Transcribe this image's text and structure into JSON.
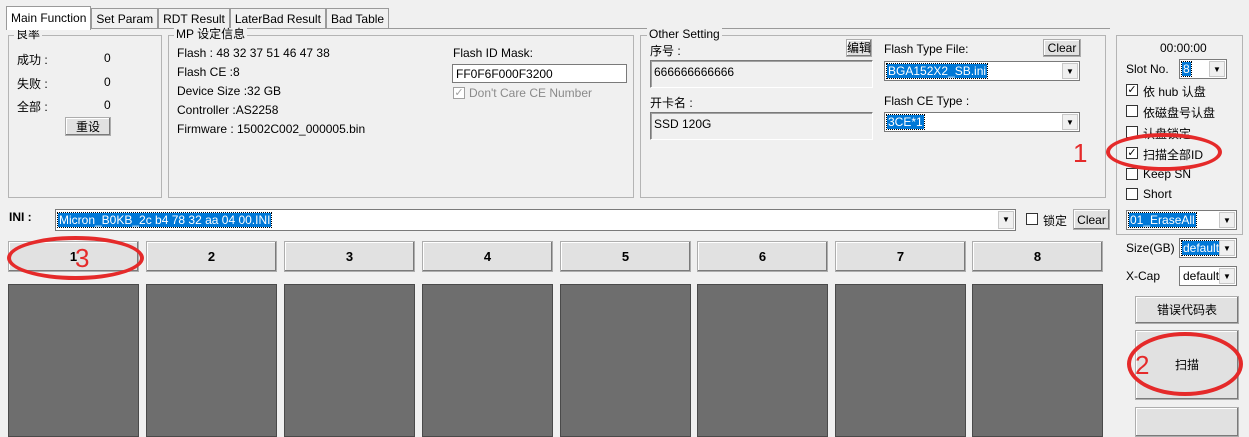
{
  "tabs": [
    "Main Function",
    "Set Param",
    "RDT Result",
    "LaterBad Result",
    "Bad Table"
  ],
  "good_group": {
    "legend": "良率",
    "rows": [
      {
        "label": "成功 :",
        "value": "0"
      },
      {
        "label": "失败 :",
        "value": "0"
      },
      {
        "label": "全部 :",
        "value": "0"
      }
    ],
    "reset_button": "重设"
  },
  "mp_info": {
    "legend": "MP 设定信息",
    "flash": "Flash :  48 32 37 51 46 47 38",
    "flash_ce": "Flash CE :8",
    "device_size": "Device Size :32 GB",
    "controller": "Controller :AS2258",
    "firmware": "Firmware : 15002C002_000005.bin",
    "flash_id_mask_label": "Flash ID Mask:",
    "flash_id_mask_value": "FF0F6F000F3200",
    "dont_care_ce_label": "Don't Care CE Number"
  },
  "other_setting": {
    "legend": "Other Setting",
    "serial_label": "序号 :",
    "edit_button": "编辑",
    "serial_value": "666666666666",
    "card_name_label": "开卡名 :",
    "card_name_value": "SSD 120G",
    "flash_type_file_label": "Flash Type File:",
    "clear_button": "Clear",
    "flash_type_file_value": "BGA152X2_SB.ini",
    "flash_ce_type_label": "Flash CE Type :",
    "flash_ce_type_value": "3CE*1"
  },
  "ini": {
    "label": "INI :",
    "value": "Micron_B0KB_2c b4 78 32 aa 04 00.INI",
    "lock_label": "锁定",
    "clear_button": "Clear"
  },
  "slots": [
    "1",
    "2",
    "3",
    "4",
    "5",
    "6",
    "7",
    "8"
  ],
  "right_panel": {
    "timer": "00:00:00",
    "slot_no_label": "Slot No.",
    "slot_no_value": "8",
    "options": [
      {
        "label": "依 hub 认盘",
        "checked": true
      },
      {
        "label": "依磁盘号认盘",
        "checked": false
      },
      {
        "label": "认盘锁定",
        "checked": false
      },
      {
        "label": "扫描全部ID",
        "checked": true
      },
      {
        "label": "Keep SN",
        "checked": false
      },
      {
        "label": "Short",
        "checked": false
      }
    ],
    "mode_value": "01_EraseAll",
    "size_label": "Size(GB)",
    "size_value": "default",
    "xcap_label": "X-Cap",
    "xcap_value": "default",
    "error_code_button": "错误代码表",
    "scan_button": "扫描"
  },
  "annotations": {
    "color": "#e52a2a",
    "numbers": [
      "1",
      "2",
      "3"
    ]
  }
}
